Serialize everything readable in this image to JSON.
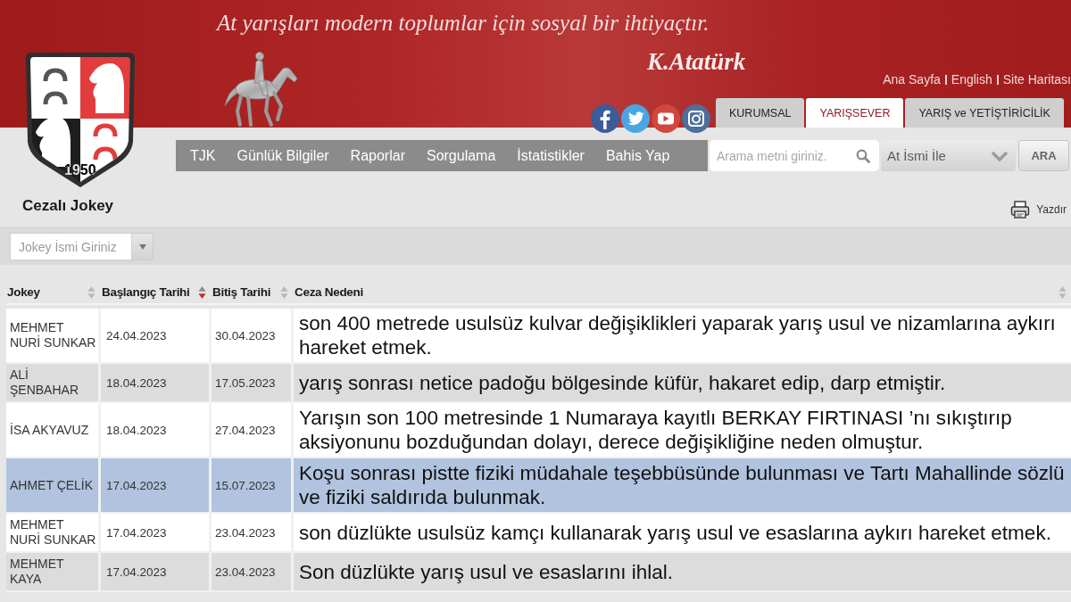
{
  "banner": {
    "slogan": "At yarışları modern toplumlar için sosyal bir ihtiyaçtır.",
    "signature": "K.Atatürk",
    "logo_year": "1950"
  },
  "top_links": [
    "Ana Sayfa",
    "English",
    "Site Haritası"
  ],
  "tabs": [
    {
      "label": "KURUMSAL",
      "selected": false
    },
    {
      "label": "YARIŞSEVER",
      "selected": true
    },
    {
      "label": "YARIŞ ve YETİŞTİRİCİLİK",
      "selected": false
    }
  ],
  "nav": [
    "TJK",
    "Günlük Bilgiler",
    "Raporlar",
    "Sorgulama",
    "İstatistikler",
    "Bahis Yap"
  ],
  "search": {
    "placeholder": "Arama metni giriniz.",
    "mode": "At İsmi İle",
    "button": "ARA"
  },
  "page_title": "Cezalı Jokey",
  "print_link": "Yazdır",
  "filter": {
    "placeholder": "Jokey İsmi Giriniz"
  },
  "table": {
    "columns": [
      {
        "label": "Jokey",
        "sorted_desc": false
      },
      {
        "label": "Başlangıç Tarihi",
        "sorted_desc": true
      },
      {
        "label": "Bitiş Tarihi",
        "sorted_desc": false
      },
      {
        "label": "Ceza Nedeni",
        "sorted_desc": false
      }
    ],
    "rows": [
      {
        "jockey": "MEHMET NURİ SUNKAR",
        "start": "24.04.2023",
        "end": "30.04.2023",
        "reason": "son 400 metrede usulsüz kulvar değişiklikleri yaparak yarış usul ve nizamlarına aykırı hareket etmek.",
        "selected": false
      },
      {
        "jockey": "ALİ ŞENBAHAR",
        "start": "18.04.2023",
        "end": "17.05.2023",
        "reason": "yarış sonrası netice padoğu bölgesinde küfür, hakaret edip, darp etmiştir.",
        "selected": false
      },
      {
        "jockey": "İSA AKYAVUZ",
        "start": "18.04.2023",
        "end": "27.04.2023",
        "reason": "Yarışın son 100 metresinde 1 Numaraya kayıtlı BERKAY FIRTINASI ’nı sıkıştırıp aksiyonunu bozduğundan dolayı, derece değişikliğine neden olmuştur.",
        "selected": false
      },
      {
        "jockey": "AHMET ÇELİK",
        "start": "17.04.2023",
        "end": "15.07.2023",
        "reason": "Koşu sonrası pistte fiziki müdahale teşebbüsünde bulunması ve Tartı Mahallinde sözlü ve fiziki saldırıda bulunmak.",
        "selected": true
      },
      {
        "jockey": "MEHMET NURİ SUNKAR",
        "start": "17.04.2023",
        "end": "23.04.2023",
        "reason": "son düzlükte usulsüz kamçı kullanarak yarış usul ve esaslarına aykırı hareket etmek.",
        "selected": false
      },
      {
        "jockey": "MEHMET KAYA",
        "start": "17.04.2023",
        "end": "23.04.2023",
        "reason": "Son düzlükte yarış usul ve esaslarını ihlal.",
        "selected": false
      }
    ]
  }
}
